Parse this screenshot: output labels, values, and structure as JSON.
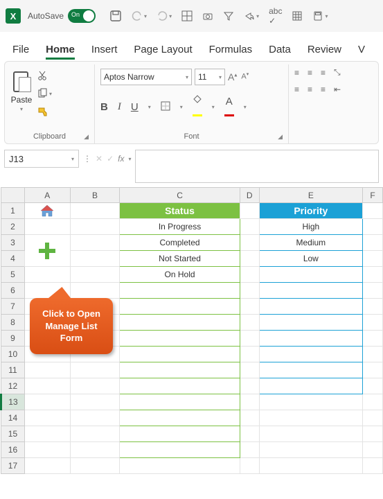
{
  "title_bar": {
    "autosave_label": "AutoSave",
    "toggle_state": "On"
  },
  "menu": {
    "tabs": [
      "File",
      "Home",
      "Insert",
      "Page Layout",
      "Formulas",
      "Data",
      "Review",
      "V"
    ],
    "active": "Home"
  },
  "ribbon": {
    "clipboard": {
      "paste_label": "Paste",
      "group_label": "Clipboard"
    },
    "font": {
      "name": "Aptos Narrow",
      "size": "11",
      "group_label": "Font"
    }
  },
  "formula": {
    "name_box": "J13",
    "fx_label": "fx",
    "value": ""
  },
  "columns": [
    "A",
    "B",
    "C",
    "D",
    "E",
    "F"
  ],
  "rows": [
    "1",
    "2",
    "3",
    "4",
    "5",
    "6",
    "7",
    "8",
    "9",
    "10",
    "11",
    "12",
    "13",
    "14",
    "15",
    "16",
    "17"
  ],
  "selected_row": 13,
  "status": {
    "header": "Status",
    "items": [
      "In Progress",
      "Completed",
      "Not Started",
      "On Hold",
      "",
      "",
      "",
      "",
      "",
      "",
      "",
      "",
      "",
      "",
      "",
      ""
    ]
  },
  "priority": {
    "header": "Priority",
    "items": [
      "High",
      "Medium",
      "Low",
      "",
      "",
      "",
      "",
      "",
      "",
      "",
      ""
    ]
  },
  "callout": {
    "line1": "Click to Open",
    "line2": "Manage List",
    "line3": "Form"
  },
  "chart_data": {
    "type": "table",
    "tables": [
      {
        "title": "Status",
        "values": [
          "In Progress",
          "Completed",
          "Not Started",
          "On Hold"
        ]
      },
      {
        "title": "Priority",
        "values": [
          "High",
          "Medium",
          "Low"
        ]
      }
    ]
  }
}
